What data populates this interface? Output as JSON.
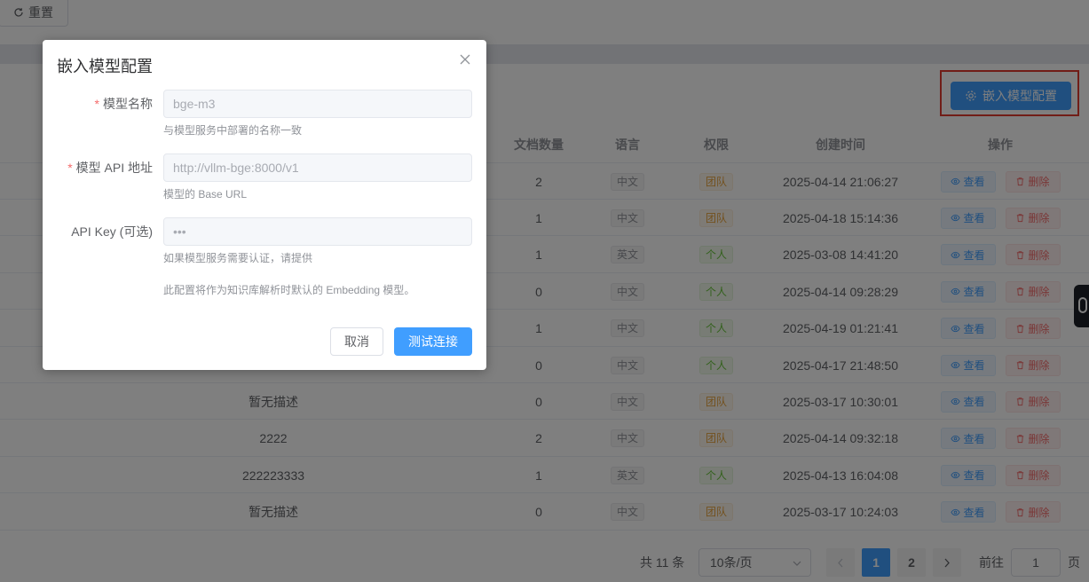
{
  "toolbar": {
    "reset_label": "重置",
    "embed_config_label": "嵌入模型配置"
  },
  "table": {
    "columns": [
      "文档数量",
      "语言",
      "权限",
      "创建时间",
      "操作"
    ],
    "rows": [
      {
        "desc": "",
        "docs": "2",
        "lang": "中文",
        "perm": "团队",
        "created": "2025-04-14 21:06:27"
      },
      {
        "desc": "",
        "docs": "1",
        "lang": "中文",
        "perm": "团队",
        "created": "2025-04-18 15:14:36"
      },
      {
        "desc": "",
        "docs": "1",
        "lang": "英文",
        "perm": "个人",
        "created": "2025-03-08 14:41:20"
      },
      {
        "desc": "",
        "docs": "0",
        "lang": "中文",
        "perm": "个人",
        "created": "2025-04-14 09:28:29"
      },
      {
        "desc": "",
        "docs": "1",
        "lang": "中文",
        "perm": "个人",
        "created": "2025-04-19 01:21:41"
      },
      {
        "desc": "",
        "docs": "0",
        "lang": "中文",
        "perm": "个人",
        "created": "2025-04-17 21:48:50"
      },
      {
        "desc": "暂无描述",
        "docs": "0",
        "lang": "中文",
        "perm": "团队",
        "created": "2025-03-17 10:30:01"
      },
      {
        "desc": "2222",
        "docs": "2",
        "lang": "中文",
        "perm": "团队",
        "created": "2025-04-14 09:32:18"
      },
      {
        "desc": "222223333",
        "docs": "1",
        "lang": "英文",
        "perm": "个人",
        "created": "2025-04-13 16:04:08"
      },
      {
        "desc": "暂无描述",
        "docs": "0",
        "lang": "中文",
        "perm": "团队",
        "created": "2025-03-17 10:24:03"
      }
    ],
    "view_label": "查看",
    "delete_label": "删除"
  },
  "pagination": {
    "total": "共 11 条",
    "page_size": "10条/页",
    "pages": [
      "1",
      "2"
    ],
    "current": "1",
    "goto_label": "前往",
    "goto_value": "1",
    "goto_unit": "页"
  },
  "dialog": {
    "title": "嵌入模型配置",
    "model_name": {
      "label": "模型名称",
      "required": "*",
      "value": "bge-m3",
      "hint": "与模型服务中部署的名称一致"
    },
    "api_url": {
      "label": "模型 API 地址",
      "required": "*",
      "value": "http://vllm-bge:8000/v1",
      "hint": "模型的 Base URL"
    },
    "api_key": {
      "label": "API Key (可选)",
      "value": "•••",
      "hint": "如果模型服务需要认证，请提供"
    },
    "note": "此配置将作为知识库解析时默认的 Embedding 模型。",
    "cancel_label": "取消",
    "test_label": "测试连接"
  },
  "colors": {
    "primary": "#409eff",
    "danger": "#f56c6c",
    "warning": "#e6a23c",
    "success": "#67c23a",
    "highlight_border": "#e23a2e"
  }
}
